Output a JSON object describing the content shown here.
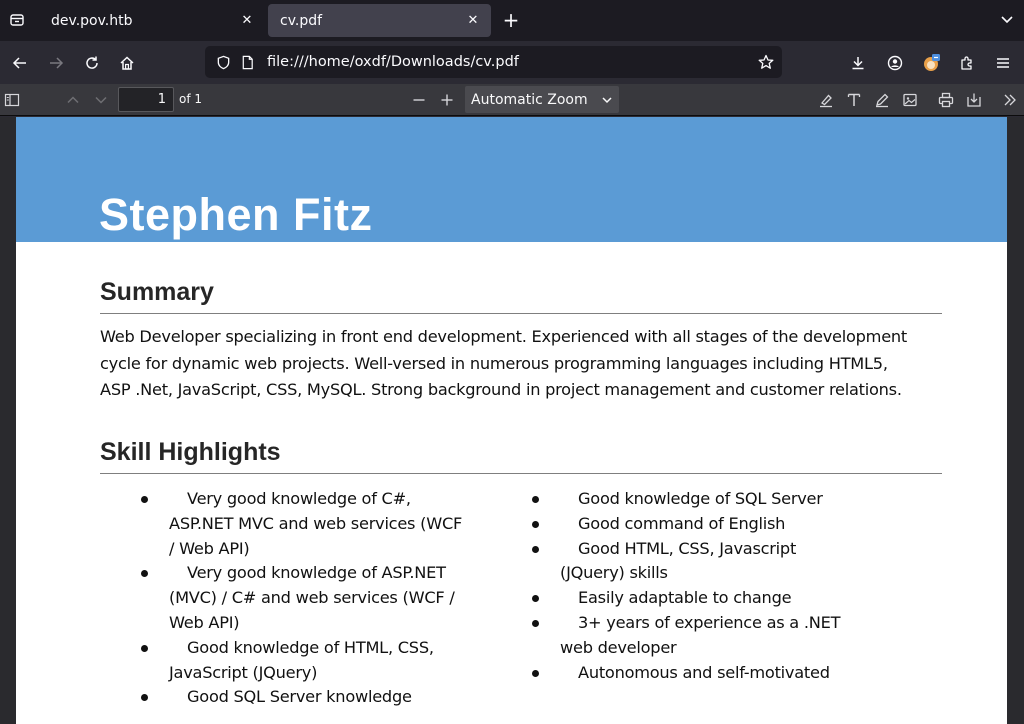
{
  "browser": {
    "tabs": [
      {
        "title": "dev.pov.htb",
        "active": false
      },
      {
        "title": "cv.pdf",
        "active": true
      }
    ],
    "url": "file:///home/oxdf/Downloads/cv.pdf"
  },
  "pdf_toolbar": {
    "page_number": "1",
    "page_count": "of 1",
    "zoom": "Automatic Zoom"
  },
  "document": {
    "name": "Stephen Fitz",
    "summary_heading": "Summary",
    "summary_lines": [
      "Web Developer specializing in front end development. Experienced with all stages of the development",
      "cycle for dynamic web projects. Well-versed in numerous programming languages including HTML5,",
      "ASP .Net, JavaScript, CSS, MySQL. Strong background in project management and customer relations."
    ],
    "skills_heading": "Skill Highlights",
    "skills_left": [
      {
        "lines": [
          "Very good knowledge of C#,",
          "ASP.NET MVC and web services (WCF",
          "/ Web API)"
        ]
      },
      {
        "lines": [
          "Very good knowledge of ASP.NET",
          "(MVC) / C# and web services (WCF /",
          "Web API)"
        ]
      },
      {
        "lines": [
          "Good knowledge of HTML, CSS,",
          "JavaScript (JQuery)"
        ]
      },
      {
        "lines": [
          "Good SQL Server knowledge"
        ]
      }
    ],
    "skills_right": [
      {
        "lines": [
          "Good knowledge of SQL Server"
        ]
      },
      {
        "lines": [
          "Good command of English"
        ]
      },
      {
        "lines": [
          "Good HTML, CSS, Javascript",
          "(JQuery) skills"
        ]
      },
      {
        "lines": [
          "Easily adaptable to change"
        ]
      },
      {
        "lines": [
          "3+ years of experience as a .NET",
          "web developer"
        ]
      },
      {
        "lines": [
          "Autonomous and self-motivated"
        ]
      }
    ]
  },
  "colors": {
    "banner": "#5b9bd5",
    "tab_active": "#42414d",
    "chrome_dark": "#1c1b22"
  }
}
